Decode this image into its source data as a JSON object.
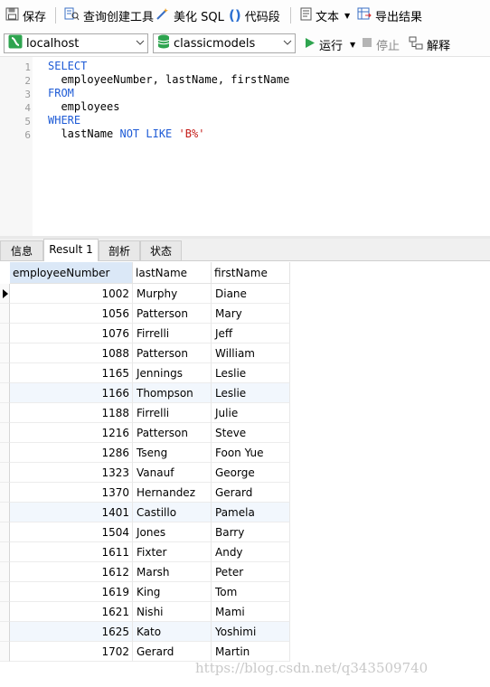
{
  "toolbar": {
    "save": "保存",
    "query_builder": "查询创建工具",
    "beautify_sql": "美化 SQL",
    "code_snippet": "代码段",
    "text": "文本",
    "export": "导出结果",
    "run": "运行",
    "stop": "停止",
    "explain": "解释"
  },
  "connection": {
    "value": "localhost"
  },
  "database": {
    "value": "classicmodels"
  },
  "editor": {
    "line_numbers": [
      "1",
      "2",
      "3",
      "4",
      "5",
      "6"
    ],
    "lines": [
      {
        "parts": [
          {
            "t": "SELECT",
            "k": "kw"
          }
        ]
      },
      {
        "parts": [
          {
            "t": "  employeeNumber, lastName, firstName",
            "k": ""
          }
        ]
      },
      {
        "parts": [
          {
            "t": "FROM",
            "k": "kw"
          }
        ]
      },
      {
        "parts": [
          {
            "t": "  employees",
            "k": ""
          }
        ]
      },
      {
        "parts": [
          {
            "t": "WHERE",
            "k": "kw"
          }
        ]
      },
      {
        "parts": [
          {
            "t": "  lastName ",
            "k": ""
          },
          {
            "t": "NOT LIKE",
            "k": "kw"
          },
          {
            "t": " ",
            "k": ""
          },
          {
            "t": "'B%'",
            "k": "str"
          }
        ]
      }
    ]
  },
  "tabs": [
    "信息",
    "Result 1",
    "剖析",
    "状态"
  ],
  "grid": {
    "columns": [
      "employeeNumber",
      "lastName",
      "firstName"
    ],
    "rows": [
      [
        "1002",
        "Murphy",
        "Diane"
      ],
      [
        "1056",
        "Patterson",
        "Mary"
      ],
      [
        "1076",
        "Firrelli",
        "Jeff"
      ],
      [
        "1088",
        "Patterson",
        "William"
      ],
      [
        "1165",
        "Jennings",
        "Leslie"
      ],
      [
        "1166",
        "Thompson",
        "Leslie"
      ],
      [
        "1188",
        "Firrelli",
        "Julie"
      ],
      [
        "1216",
        "Patterson",
        "Steve"
      ],
      [
        "1286",
        "Tseng",
        "Foon Yue"
      ],
      [
        "1323",
        "Vanauf",
        "George"
      ],
      [
        "1370",
        "Hernandez",
        "Gerard"
      ],
      [
        "1401",
        "Castillo",
        "Pamela"
      ],
      [
        "1504",
        "Jones",
        "Barry"
      ],
      [
        "1611",
        "Fixter",
        "Andy"
      ],
      [
        "1612",
        "Marsh",
        "Peter"
      ],
      [
        "1619",
        "King",
        "Tom"
      ],
      [
        "1621",
        "Nishi",
        "Mami"
      ],
      [
        "1625",
        "Kato",
        "Yoshimi"
      ],
      [
        "1702",
        "Gerard",
        "Martin"
      ]
    ]
  },
  "watermark": "https://blog.csdn.net/q343509740",
  "colors": {
    "keyword": "#1e5bd6",
    "string": "#c41a16",
    "run_green": "#2ea44f",
    "selected_header": "#dbe8f7"
  },
  "icons": [
    "save-icon",
    "query-builder-icon",
    "beautify-icon",
    "code-snippet-icon",
    "text-icon",
    "export-icon",
    "connection-icon",
    "database-icon",
    "run-icon",
    "stop-icon",
    "explain-icon"
  ]
}
